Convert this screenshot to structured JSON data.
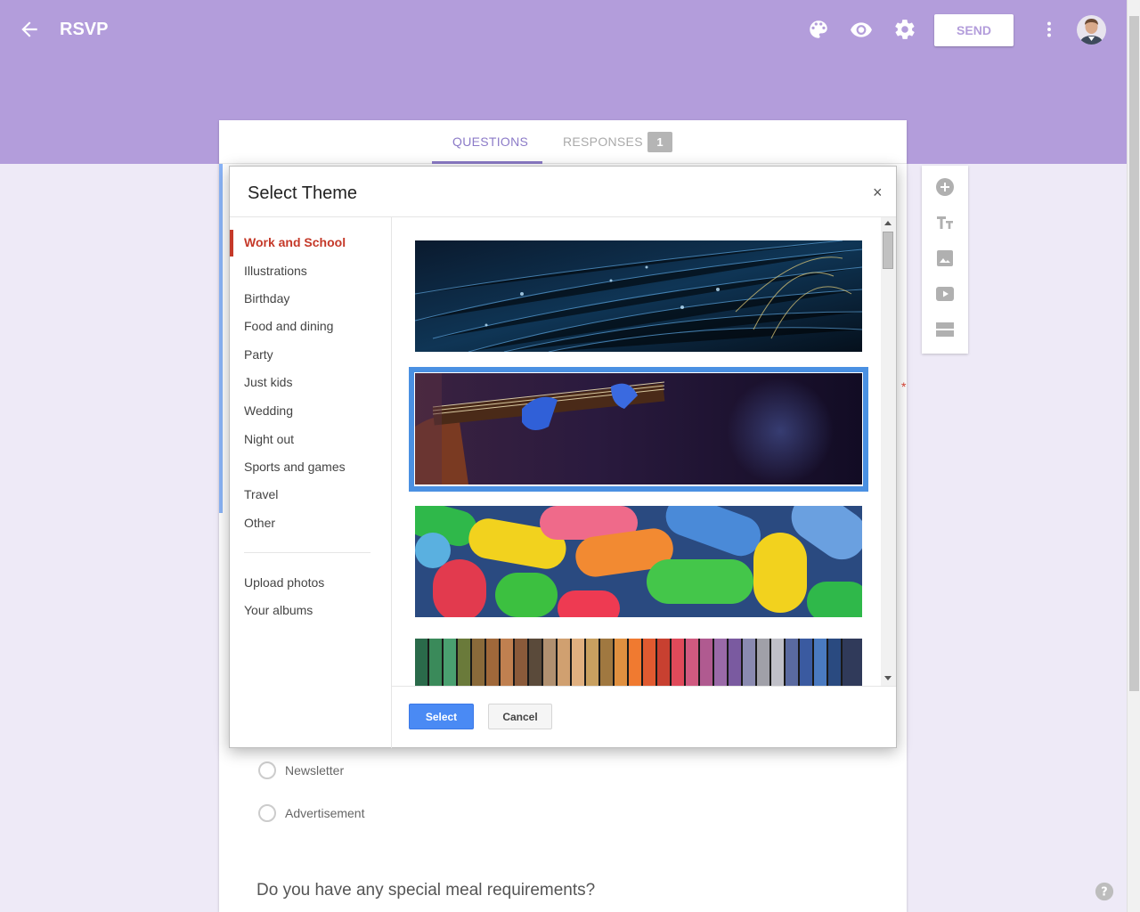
{
  "header": {
    "title": "RSVP",
    "send_label": "SEND",
    "brand_color": "#b39ddb",
    "icons": [
      "back-arrow-icon",
      "palette-icon",
      "eye-icon",
      "gear-icon",
      "more-vert-icon"
    ]
  },
  "tabs": {
    "questions": "QUESTIONS",
    "responses": "RESPONSES",
    "responses_count": "1"
  },
  "form": {
    "options": [
      "Newsletter",
      "Advertisement"
    ],
    "question": "Do you have any special meal requirements?",
    "required_mark": "*"
  },
  "side_toolbar": [
    "add-question-icon",
    "title-text-icon",
    "image-icon",
    "video-icon",
    "section-icon"
  ],
  "dialog": {
    "title": "Select Theme",
    "close": "×",
    "categories": [
      "Work and School",
      "Illustrations",
      "Birthday",
      "Food and dining",
      "Party",
      "Just kids",
      "Wedding",
      "Night out",
      "Sports and games",
      "Travel",
      "Other"
    ],
    "active_category": "Work and School",
    "extra_links": [
      "Upload photos",
      "Your albums"
    ],
    "themes": [
      "fiber-optic-theme",
      "guitar-theme",
      "jellybeans-theme",
      "yarn-theme"
    ],
    "selected_theme": "guitar-theme",
    "select_label": "Select",
    "cancel_label": "Cancel"
  }
}
